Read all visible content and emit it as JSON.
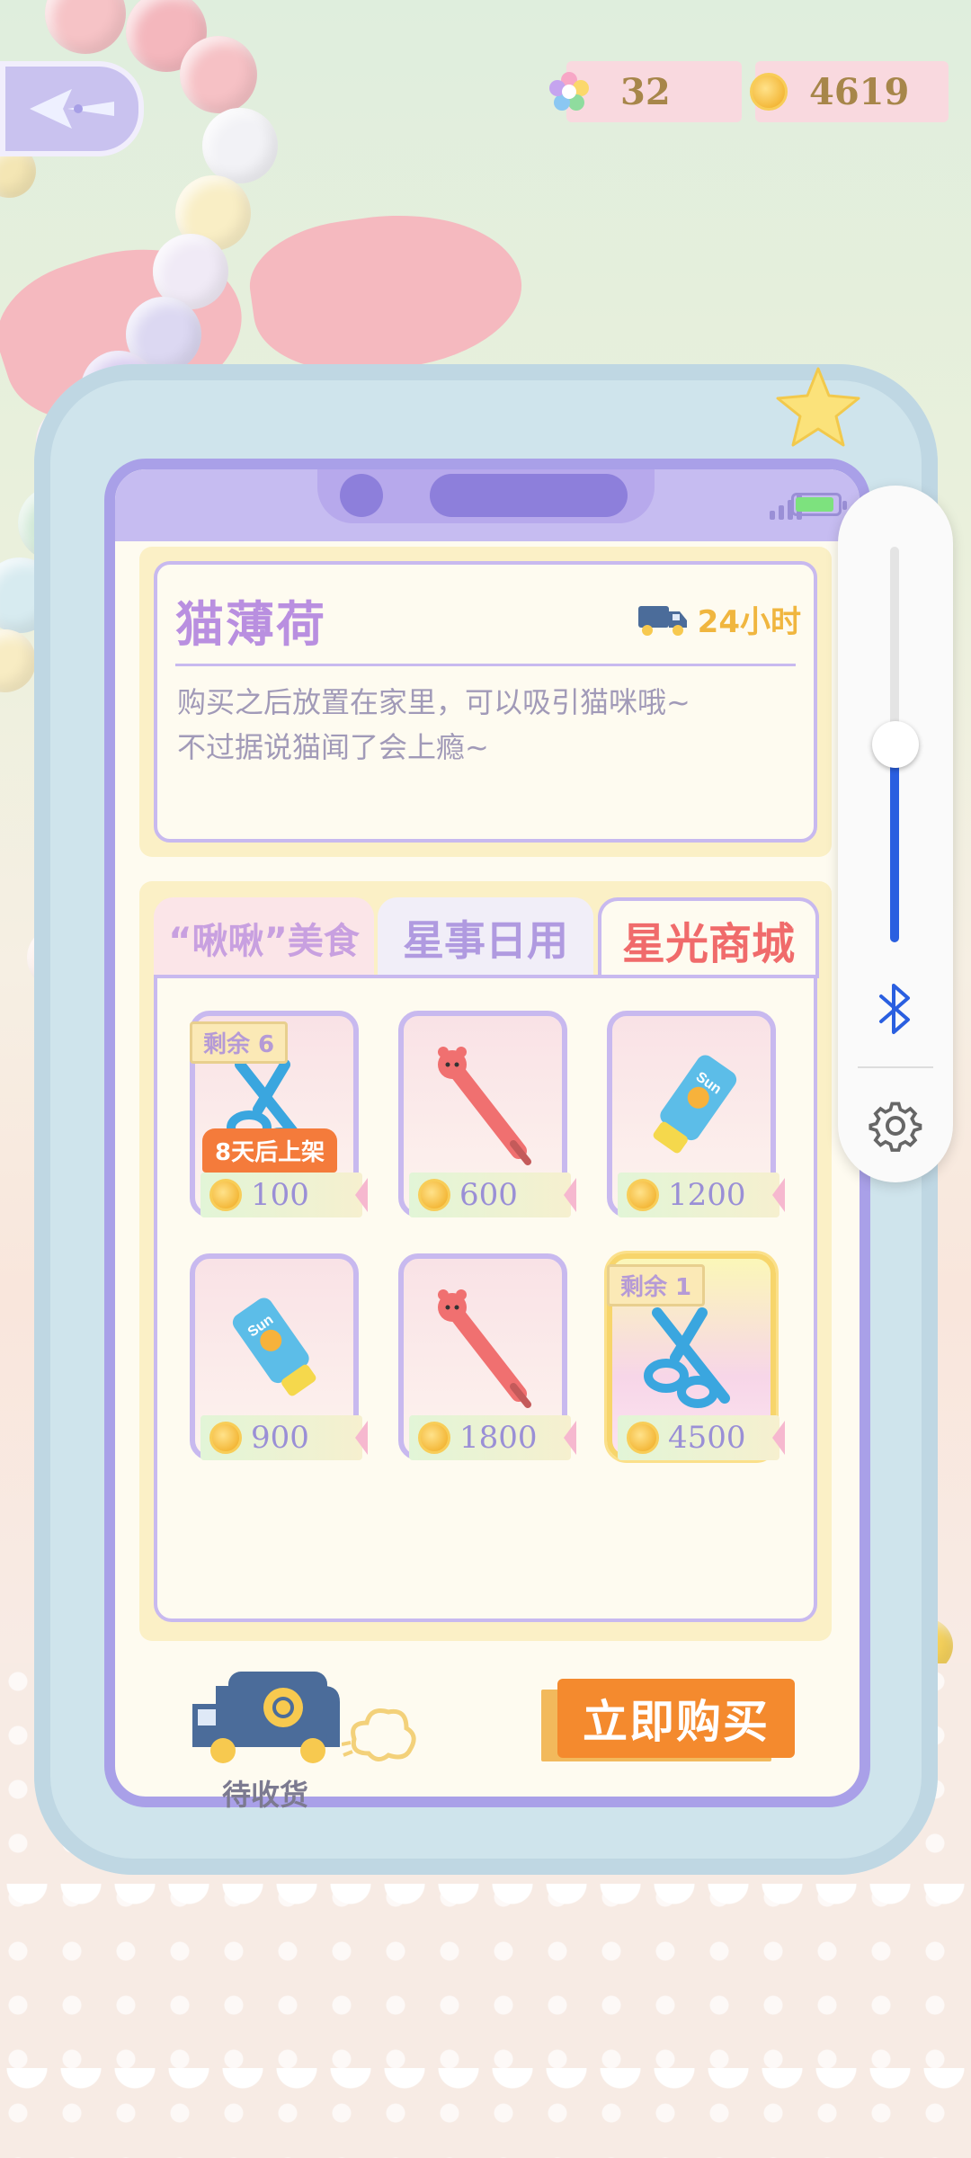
{
  "header": {
    "back_icon": "back-arrow-icon",
    "gems": {
      "icon": "rainbow-star-icon",
      "value": "32"
    },
    "coins": {
      "icon": "coin-icon",
      "value": "4619"
    }
  },
  "device": {
    "status": {
      "signal_icon": "signal-icon",
      "battery_icon": "battery-icon"
    }
  },
  "item_detail": {
    "name": "猫薄荷",
    "delivery_icon": "delivery-truck-icon",
    "delivery_time": "24小时",
    "description_line1": "购买之后放置在家里，可以吸引猫咪哦~",
    "description_line2": "不过据说猫闻了会上瘾~"
  },
  "tabs": [
    {
      "label": "“啾啾”美食",
      "selected": false
    },
    {
      "label": "星事日用",
      "selected": false
    },
    {
      "label": "星光商城",
      "selected": true
    }
  ],
  "items": [
    {
      "icon": "scissors-icon",
      "price": "100",
      "stock": "剩余 6",
      "badge": "8天后上架",
      "highlight": false
    },
    {
      "icon": "pen-icon",
      "price": "600",
      "stock": "",
      "badge": "",
      "highlight": false
    },
    {
      "icon": "sunscreen-tube-icon",
      "price": "1200",
      "stock": "",
      "badge": "",
      "highlight": false
    },
    {
      "icon": "sunscreen-tube-icon",
      "price": "900",
      "stock": "",
      "badge": "",
      "highlight": false
    },
    {
      "icon": "pen-icon",
      "price": "1800",
      "stock": "",
      "badge": "",
      "highlight": false
    },
    {
      "icon": "scissors-icon",
      "price": "4500",
      "stock": "剩余 1",
      "badge": "",
      "highlight": true
    }
  ],
  "footer": {
    "pending_label": "待收货",
    "pending_icon": "delivery-van-icon",
    "buy_label": "立即购买"
  },
  "control_panel": {
    "volume_level": 0.5,
    "bluetooth_icon": "bluetooth-icon",
    "settings_icon": "gear-icon"
  },
  "colors": {
    "accent": "#f48a2e",
    "tab_selected": "#f06b6b",
    "frame": "#c8b9ef",
    "price_text": "#9a8fd6",
    "volume": "#2a5fe0"
  }
}
